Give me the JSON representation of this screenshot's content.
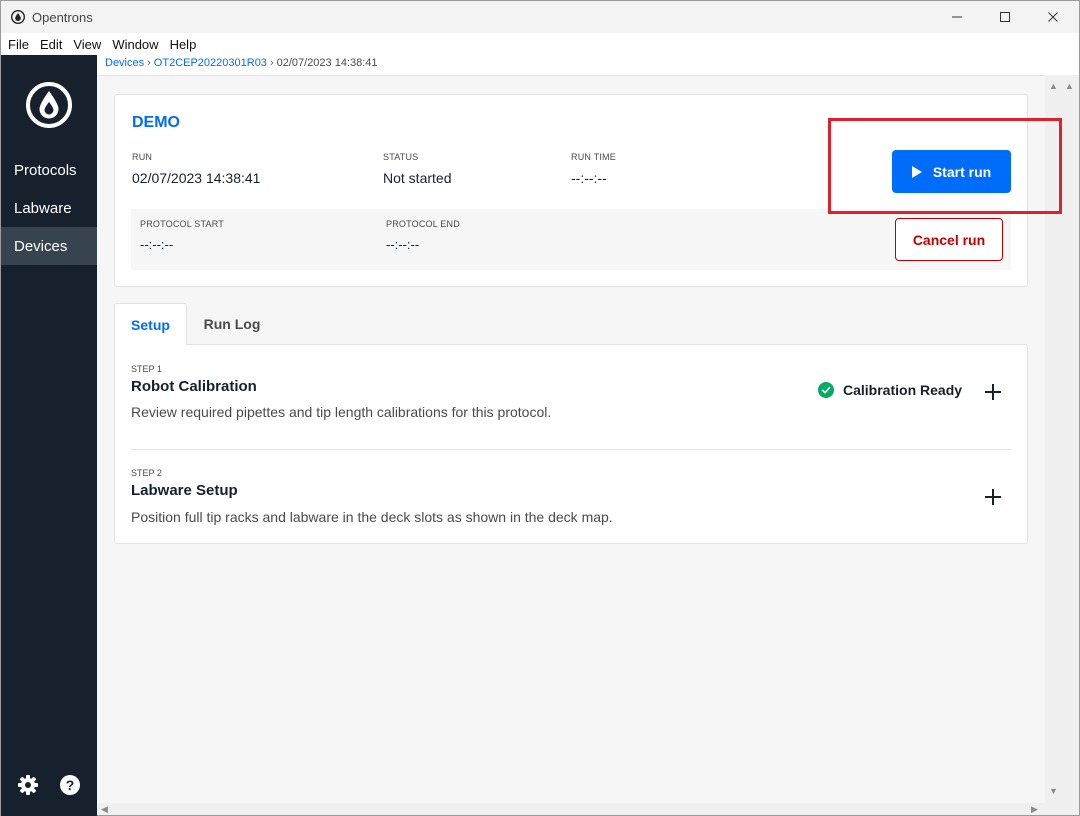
{
  "window": {
    "title": "Opentrons"
  },
  "menu": [
    "File",
    "Edit",
    "View",
    "Window",
    "Help"
  ],
  "sidebar": {
    "items": [
      {
        "label": "Protocols",
        "active": false
      },
      {
        "label": "Labware",
        "active": false
      },
      {
        "label": "Devices",
        "active": true
      }
    ],
    "bottom_icons": [
      "settings-gear-icon",
      "help-icon"
    ]
  },
  "breadcrumb": {
    "items": [
      "Devices",
      "OT2CEP20220301R03"
    ],
    "current": "02/07/2023 14:38:41",
    "separator": "›"
  },
  "run": {
    "name": "DEMO",
    "run_label": "RUN",
    "run_value": "02/07/2023 14:38:41",
    "status_label": "STATUS",
    "status_value": "Not started",
    "time_label": "RUN TIME",
    "time_value": "--:--:--",
    "start_label": "PROTOCOL START",
    "start_value": "--:--:--",
    "end_label": "PROTOCOL END",
    "end_value": "--:--:--",
    "start_button": "Start run",
    "cancel_button": "Cancel run"
  },
  "tabs": [
    {
      "label": "Setup",
      "active": true
    },
    {
      "label": "Run Log",
      "active": false
    }
  ],
  "steps": [
    {
      "label": "STEP 1",
      "title": "Robot Calibration",
      "description": "Review required pipettes and tip length calibrations for this protocol.",
      "status": "Calibration Ready"
    },
    {
      "label": "STEP 2",
      "title": "Labware Setup",
      "description": "Position full tip racks and labware in the deck slots as shown in the deck map."
    }
  ],
  "colors": {
    "accent": "#006cfa",
    "sidebar": "#16212d",
    "danger": "#bf0000",
    "success": "#04aa65",
    "highlight": "#e0202a"
  }
}
